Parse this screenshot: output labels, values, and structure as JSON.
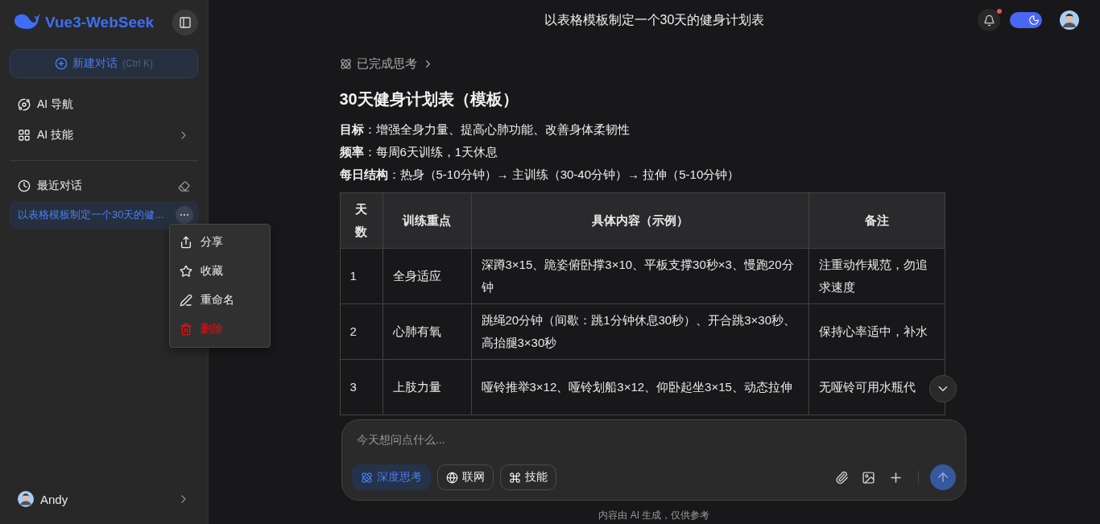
{
  "sidebar": {
    "logo_text": "Vue3-WebSeek",
    "new_chat": {
      "label": "新建对话",
      "shortcut": "(Ctrl K)"
    },
    "nav_items": [
      {
        "label": "AI 导航",
        "kind": "link"
      },
      {
        "label": "AI 技能",
        "kind": "submenu"
      }
    ],
    "recent_title": "最近对话",
    "history": [
      {
        "title": "以表格模板制定一个30天的健...",
        "selected": true
      }
    ],
    "context_menu": [
      {
        "label": "分享",
        "kind": "share"
      },
      {
        "label": "收藏",
        "kind": "favorite"
      },
      {
        "label": "重命名",
        "kind": "rename"
      },
      {
        "label": "删除",
        "kind": "delete"
      }
    ],
    "user": {
      "name": "Andy"
    }
  },
  "header": {
    "title": "以表格模板制定一个30天的健身计划表",
    "has_unread": true,
    "dark_mode": true
  },
  "thinking": {
    "label": "已完成思考"
  },
  "article": {
    "heading": "30天健身计划表（模板）",
    "paragraphs": [
      "**目标**：增强全身力量、提高心肺功能、改善身体柔韧性",
      "**频率**：每周6天训练，1天休息",
      "**每日结构**：热身（5-10分钟）→ 主训练（30-40分钟）→ 拉伸（5-10分钟）"
    ],
    "table": {
      "columns": [
        "天数",
        "训练重点",
        "具体内容（示例）",
        "备注"
      ],
      "rows": [
        [
          "1",
          "全身适应",
          "深蹲3×15、跪姿俯卧撑3×10、平板支撑30秒×3、慢跑20分钟",
          "注重动作规范，勿追求速度"
        ],
        [
          "2",
          "心肺有氧",
          "跳绳20分钟（间歇：跳1分钟休息30秒）、开合跳3×30秒、高抬腿3×30秒",
          "保持心率适中，补水"
        ],
        [
          "3",
          "上肢力量",
          "哑铃推举3×12、哑铃划船3×12、仰卧起坐3×15、动态拉伸",
          "无哑铃可用水瓶代"
        ]
      ]
    }
  },
  "composer": {
    "placeholder": "今天想问点什么...",
    "chips": [
      {
        "label": "深度思考",
        "kind": "think",
        "selected": true
      },
      {
        "label": "联网",
        "kind": "web",
        "selected": false
      },
      {
        "label": "技能",
        "kind": "skill",
        "selected": false
      }
    ]
  },
  "footer": "内容由 AI 生成，仅供参考"
}
